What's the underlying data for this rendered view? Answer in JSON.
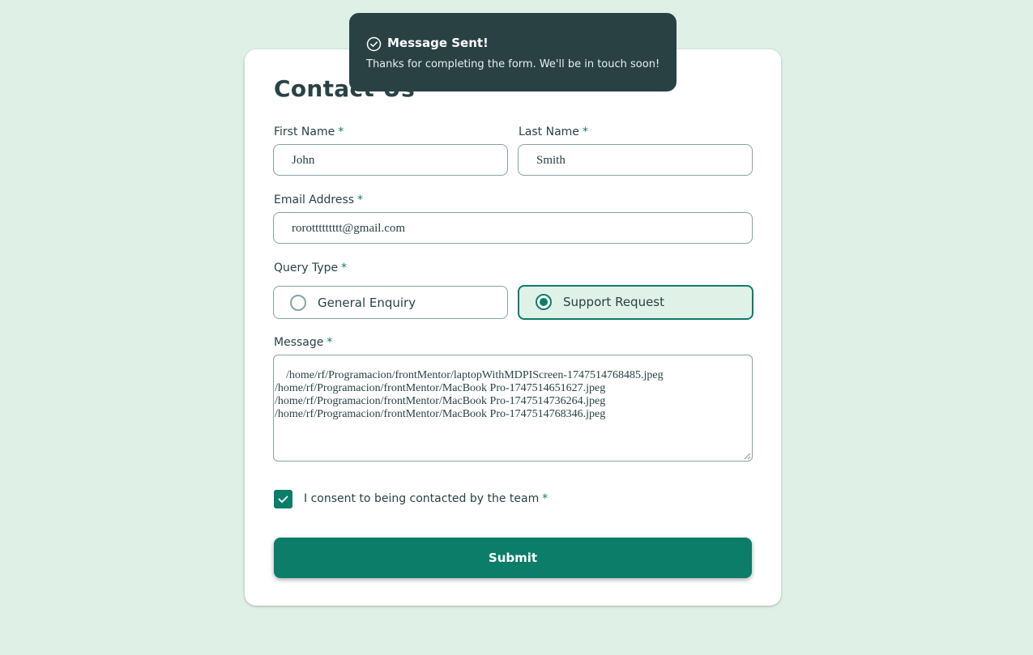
{
  "form": {
    "title": "Contact Us",
    "first_name": {
      "label": "First Name",
      "required": "*",
      "value": "John"
    },
    "last_name": {
      "label": "Last Name",
      "required": "*",
      "value": "Smith"
    },
    "email": {
      "label": "Email Address",
      "required": "*",
      "value": "rorottttttttt@gmail.com"
    },
    "query_type": {
      "label": "Query Type",
      "required": "*",
      "options": [
        "General Enquiry",
        "Support Request"
      ],
      "selected": "Support Request"
    },
    "message": {
      "label": "Message",
      "required": "*",
      "value": "/home/rf/Programacion/frontMentor/laptopWithMDPIScreen-1747514768485.jpeg\n/home/rf/Programacion/frontMentor/MacBook Pro-1747514651627.jpeg\n/home/rf/Programacion/frontMentor/MacBook Pro-1747514736264.jpeg\n/home/rf/Programacion/frontMentor/MacBook Pro-1747514768346.jpeg"
    },
    "consent": {
      "label": "I consent to being contacted by the team",
      "required": "*",
      "checked": true
    },
    "submit_label": "Submit"
  },
  "toast": {
    "title": "Message Sent!",
    "message": "Thanks for completing the form. We'll be in touch soon!"
  },
  "colors": {
    "background": "#dff0e6",
    "accent": "#0c7d69",
    "toast_bg": "#2a4144",
    "text": "#2a4244",
    "border": "#87a3a6"
  }
}
